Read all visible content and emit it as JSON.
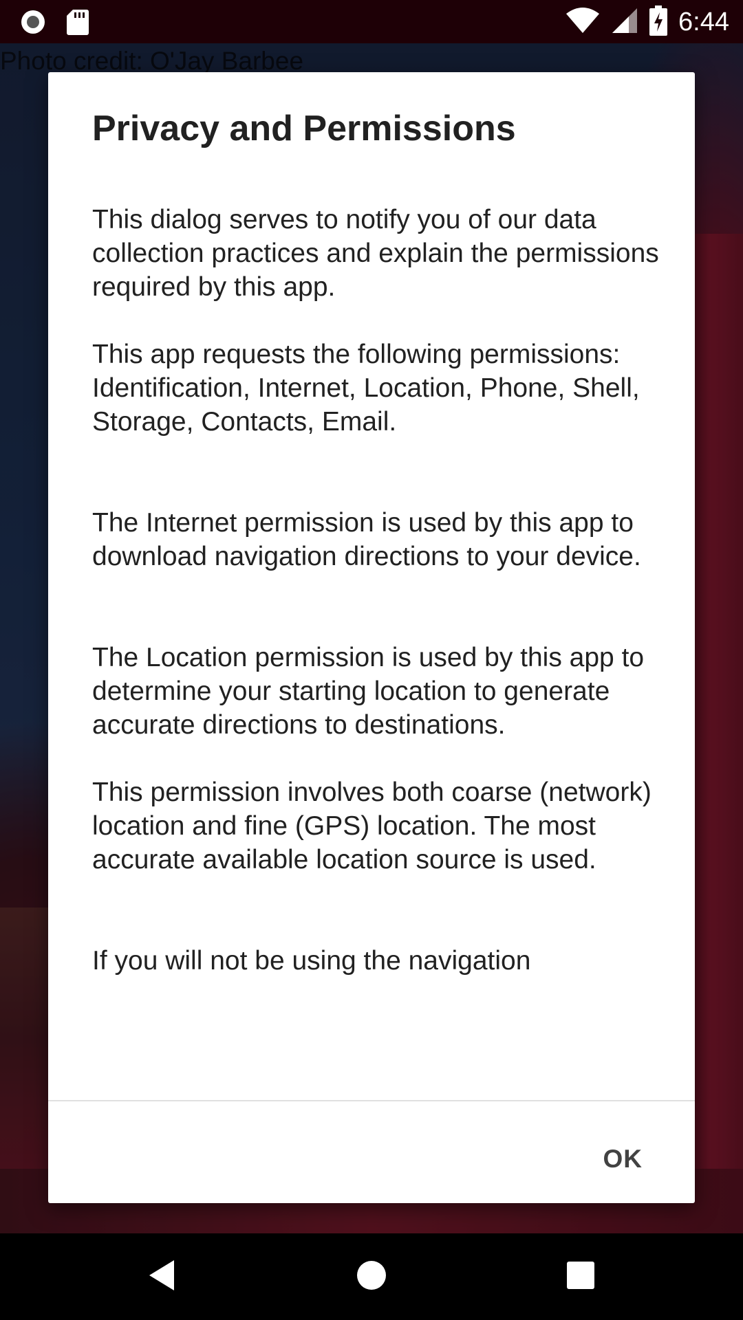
{
  "status_bar": {
    "time": "6:44",
    "left_icons": [
      "record-icon",
      "sd-card-icon"
    ],
    "right_icons": [
      "wifi-icon",
      "cell-signal-icon",
      "battery-charging-icon"
    ]
  },
  "background": {
    "photo_credit": "Photo credit: O'Jay Barbee"
  },
  "dialog": {
    "title": "Privacy and Permissions",
    "paragraphs": [
      "This dialog serves to notify you of our data collection practices and explain the permissions required by this app.",
      "This app requests the following permissions: Identification, Internet, Location, Phone, Shell, Storage, Contacts, Email.",
      "The Internet permission is used by this app to download navigation directions to your device.",
      "The Location permission is used by this app to determine your starting location to generate accurate directions to destinations.",
      "This permission involves both coarse (network) location and fine (GPS) location. The most accurate available location source is used.",
      "If you will not be using the navigation"
    ],
    "ok_label": "OK"
  },
  "nav_bar": {
    "items": [
      "back-icon",
      "home-icon",
      "recents-icon"
    ]
  }
}
